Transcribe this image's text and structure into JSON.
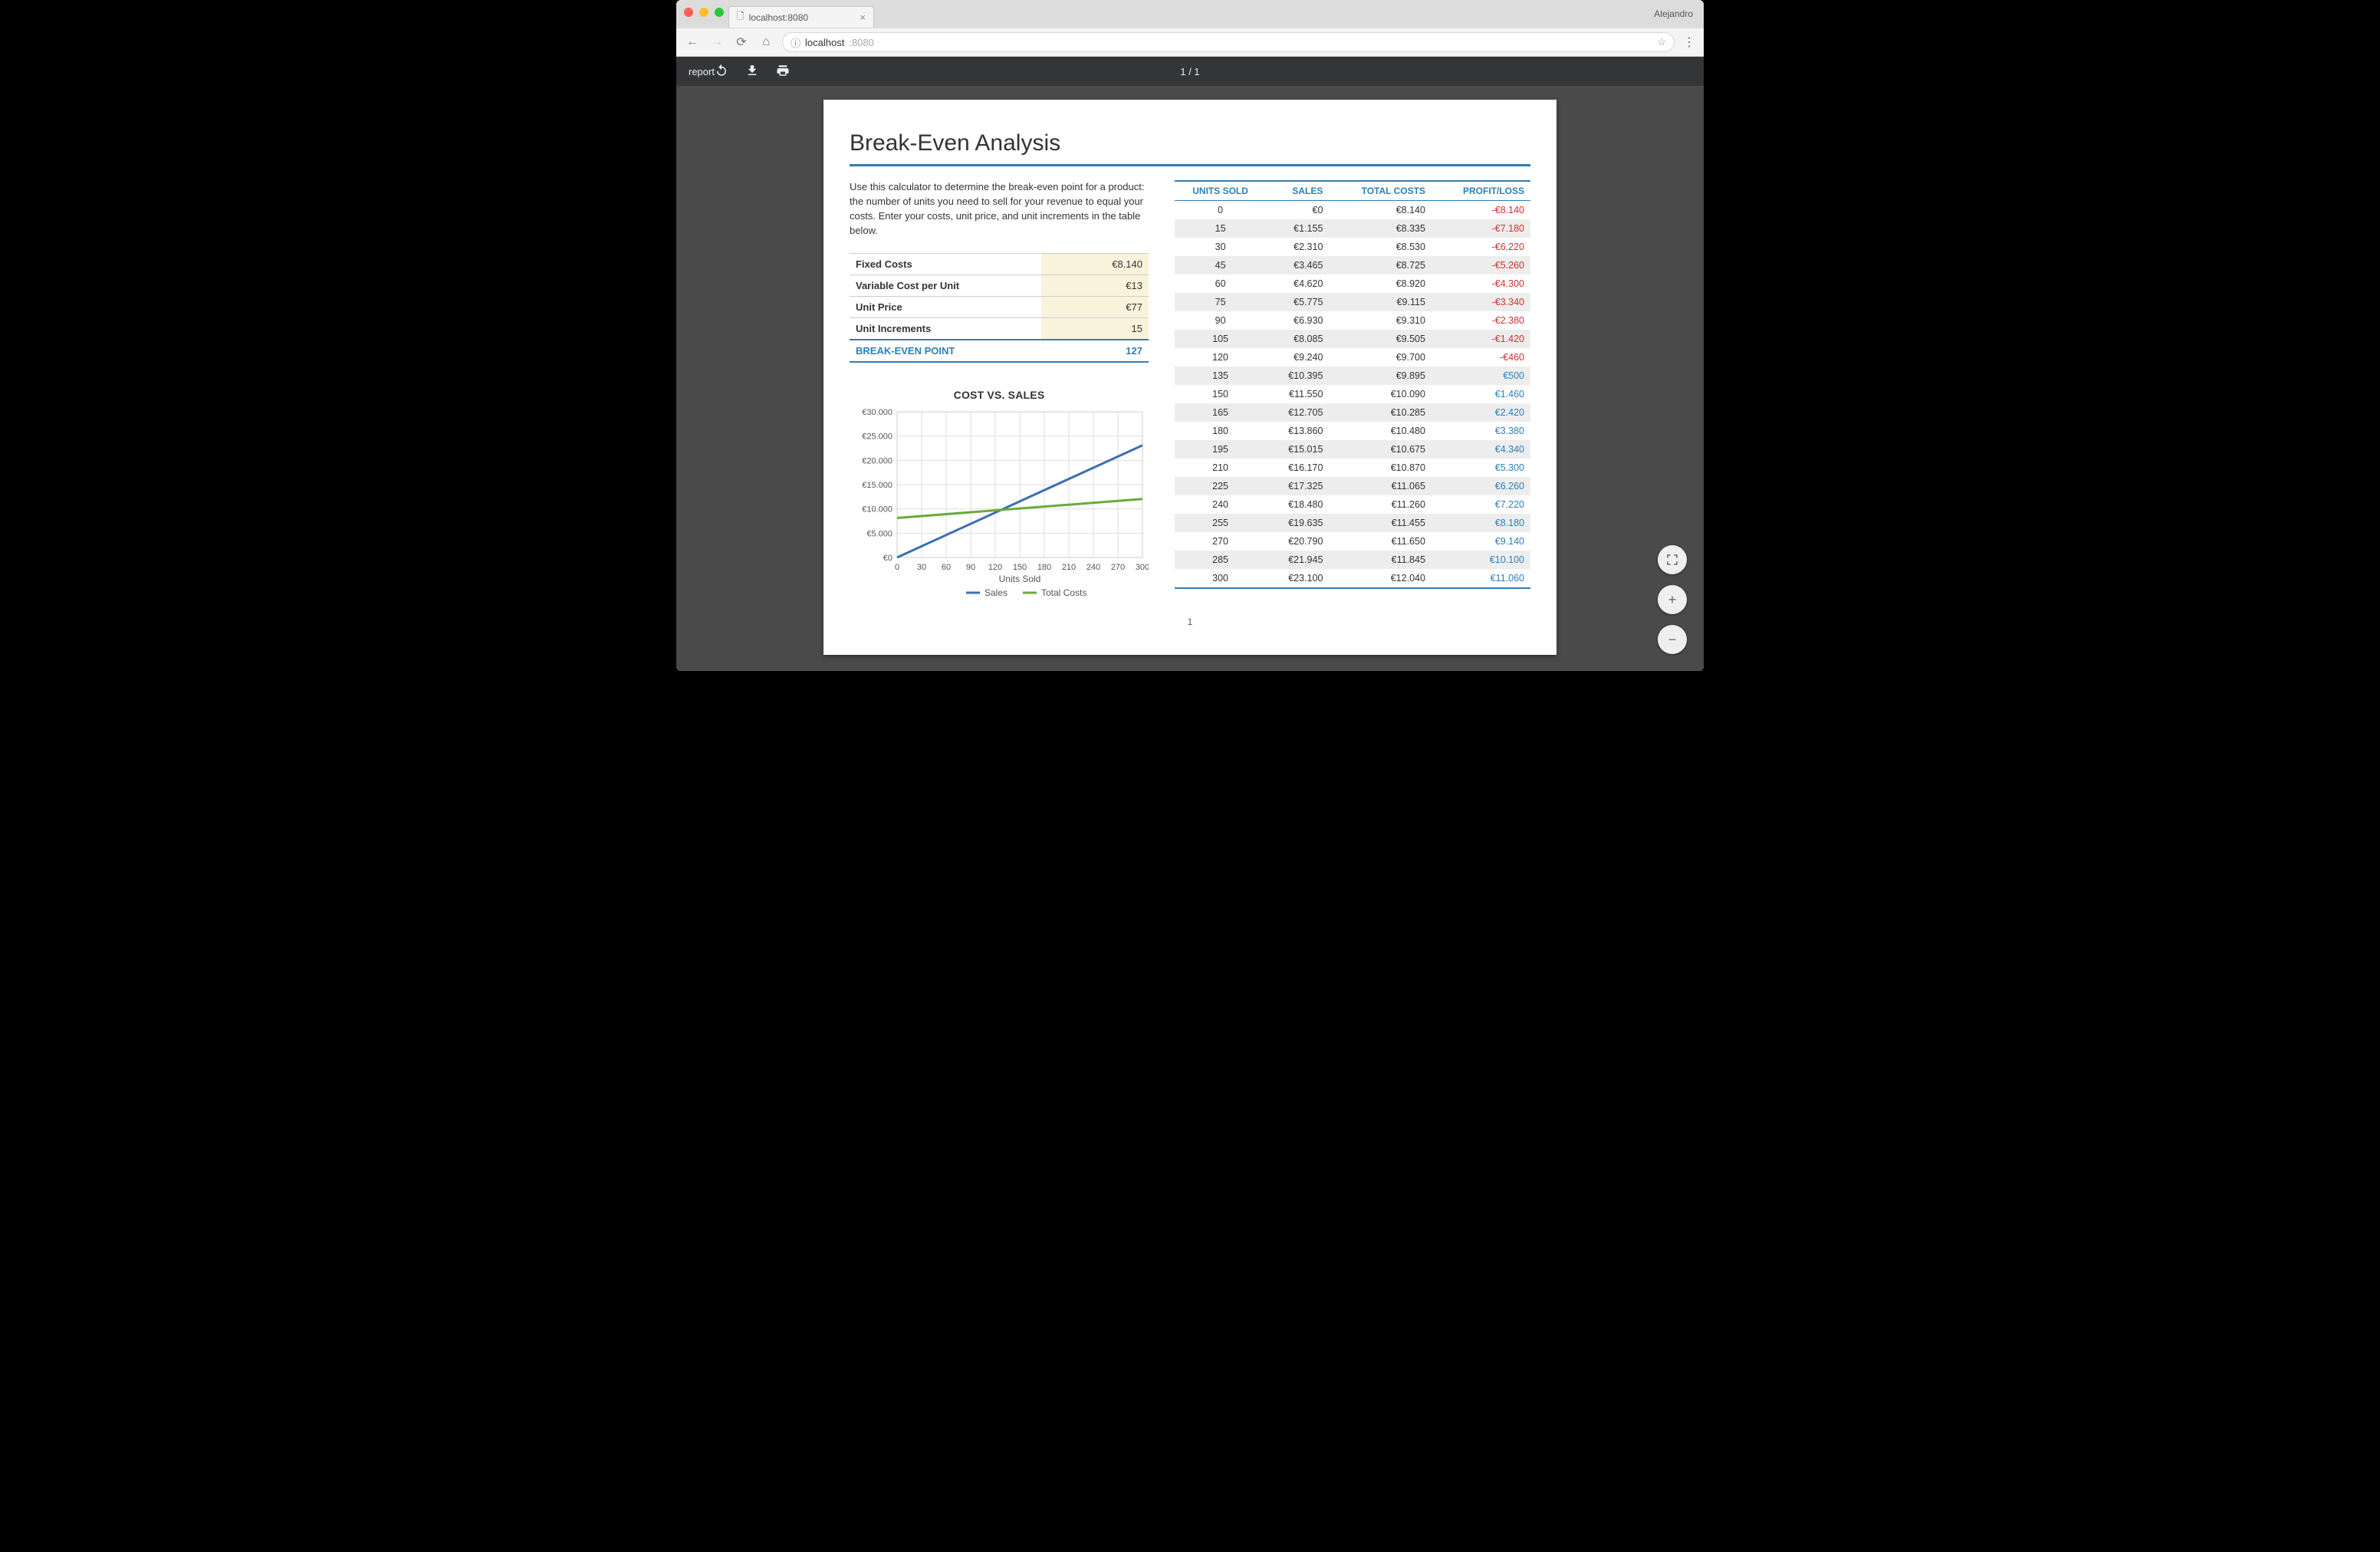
{
  "browser": {
    "tab_title": "localhost:8080",
    "profile_name": "Alejandro",
    "url_prefix_icon": "ⓘ",
    "url_host": "localhost",
    "url_port": ":8080"
  },
  "viewer": {
    "doc_name": "report",
    "page_indicator": "1 / 1"
  },
  "doc": {
    "title": "Break-Even Analysis",
    "intro": "Use this calculator to determine the break-even point for a product: the number of units you need to sell for your revenue to equal your costs. Enter your costs, unit price, and unit increments in the table below.",
    "inputs": {
      "fixed_label": "Fixed Costs",
      "fixed_value": "€8.140",
      "var_label": "Variable Cost per Unit",
      "var_value": "€13",
      "price_label": "Unit Price",
      "price_value": "€77",
      "inc_label": "Unit Increments",
      "inc_value": "15",
      "bep_label": "BREAK-EVEN POINT",
      "bep_value": "127"
    },
    "chart_title": "COST VS. SALES",
    "data_headers": {
      "units": "UNITS SOLD",
      "sales": "SALES",
      "costs": "TOTAL COSTS",
      "pl": "PROFIT/LOSS"
    },
    "data_rows": [
      {
        "units": "0",
        "sales": "€0",
        "costs": "€8.140",
        "pl": "-€8.140",
        "neg": true
      },
      {
        "units": "15",
        "sales": "€1.155",
        "costs": "€8.335",
        "pl": "-€7.180",
        "neg": true
      },
      {
        "units": "30",
        "sales": "€2.310",
        "costs": "€8.530",
        "pl": "-€6.220",
        "neg": true
      },
      {
        "units": "45",
        "sales": "€3.465",
        "costs": "€8.725",
        "pl": "-€5.260",
        "neg": true
      },
      {
        "units": "60",
        "sales": "€4.620",
        "costs": "€8.920",
        "pl": "-€4.300",
        "neg": true
      },
      {
        "units": "75",
        "sales": "€5.775",
        "costs": "€9.115",
        "pl": "-€3.340",
        "neg": true
      },
      {
        "units": "90",
        "sales": "€6.930",
        "costs": "€9.310",
        "pl": "-€2.380",
        "neg": true
      },
      {
        "units": "105",
        "sales": "€8.085",
        "costs": "€9.505",
        "pl": "-€1.420",
        "neg": true
      },
      {
        "units": "120",
        "sales": "€9.240",
        "costs": "€9.700",
        "pl": "-€460",
        "neg": true
      },
      {
        "units": "135",
        "sales": "€10.395",
        "costs": "€9.895",
        "pl": "€500",
        "neg": false
      },
      {
        "units": "150",
        "sales": "€11.550",
        "costs": "€10.090",
        "pl": "€1.460",
        "neg": false
      },
      {
        "units": "165",
        "sales": "€12.705",
        "costs": "€10.285",
        "pl": "€2.420",
        "neg": false
      },
      {
        "units": "180",
        "sales": "€13.860",
        "costs": "€10.480",
        "pl": "€3.380",
        "neg": false
      },
      {
        "units": "195",
        "sales": "€15.015",
        "costs": "€10.675",
        "pl": "€4.340",
        "neg": false
      },
      {
        "units": "210",
        "sales": "€16.170",
        "costs": "€10.870",
        "pl": "€5.300",
        "neg": false
      },
      {
        "units": "225",
        "sales": "€17.325",
        "costs": "€11.065",
        "pl": "€6.260",
        "neg": false
      },
      {
        "units": "240",
        "sales": "€18.480",
        "costs": "€11.260",
        "pl": "€7.220",
        "neg": false
      },
      {
        "units": "255",
        "sales": "€19.635",
        "costs": "€11.455",
        "pl": "€8.180",
        "neg": false
      },
      {
        "units": "270",
        "sales": "€20.790",
        "costs": "€11.650",
        "pl": "€9.140",
        "neg": false
      },
      {
        "units": "285",
        "sales": "€21.945",
        "costs": "€11.845",
        "pl": "€10.100",
        "neg": false
      },
      {
        "units": "300",
        "sales": "€23.100",
        "costs": "€12.040",
        "pl": "€11.060",
        "neg": false
      }
    ],
    "page_number": "1"
  },
  "chart_data": {
    "type": "line",
    "title": "COST VS. SALES",
    "xlabel": "Units Sold",
    "ylabel": "",
    "x_ticks": [
      "0",
      "30",
      "60",
      "90",
      "120",
      "150",
      "180",
      "210",
      "240",
      "270",
      "300"
    ],
    "y_ticks": [
      "€0",
      "€5.000",
      "€10.000",
      "€15.000",
      "€20.000",
      "€25.000",
      "€30.000"
    ],
    "xlim": [
      0,
      300
    ],
    "ylim": [
      0,
      30000
    ],
    "series": [
      {
        "name": "Sales",
        "color": "#3b6fb6",
        "x": [
          0,
          300
        ],
        "y": [
          0,
          23100
        ]
      },
      {
        "name": "Total Costs",
        "color": "#6aaa3b",
        "x": [
          0,
          300
        ],
        "y": [
          8140,
          12040
        ]
      }
    ],
    "legend": [
      "Sales",
      "Total Costs"
    ]
  }
}
